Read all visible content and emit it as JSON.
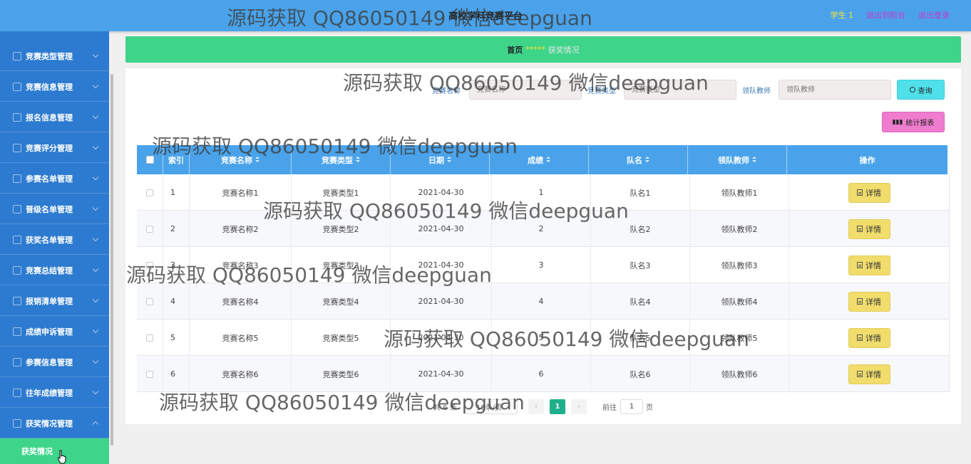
{
  "header": {
    "title": "高校学科竞赛平台",
    "user": "学生 1",
    "front_link": "退出到前台",
    "logout_link": "退出登录"
  },
  "sidebar": {
    "items": [
      {
        "label": "竞赛类型管理",
        "icon": "grid-icon"
      },
      {
        "label": "竞赛信息管理",
        "icon": "briefcase-icon"
      },
      {
        "label": "报名信息管理",
        "icon": "chat-icon"
      },
      {
        "label": "竞赛评分管理",
        "icon": "bar-chart-icon"
      },
      {
        "label": "参赛名单管理",
        "icon": "trash-icon"
      },
      {
        "label": "晋级名单管理",
        "icon": "user-icon"
      },
      {
        "label": "获奖名单管理",
        "icon": "user-icon"
      },
      {
        "label": "竞赛总结管理",
        "icon": "flag-icon"
      },
      {
        "label": "报销清单管理",
        "icon": "bulb-icon"
      },
      {
        "label": "成绩申诉管理",
        "icon": "list-icon"
      },
      {
        "label": "参赛信息管理",
        "icon": "copy-icon"
      },
      {
        "label": "往年成绩管理",
        "icon": "video-icon"
      },
      {
        "label": "获奖情况管理",
        "icon": "list-icon"
      }
    ],
    "active_sub_item": "获奖情况"
  },
  "breadcrumb": {
    "home": "首页",
    "separator": "*****",
    "current": "获奖情况"
  },
  "search": {
    "name_label": "竞赛名称",
    "name_placeholder": "竞赛名称",
    "type_label": "竞赛类型",
    "type_placeholder": "竞赛类型",
    "teacher_label": "领队教师",
    "teacher_placeholder": "领队教师",
    "query_button": "查询"
  },
  "report_button": "统计报表",
  "table": {
    "columns": [
      "索引",
      "竞赛名称",
      "竞赛类型",
      "日期",
      "成绩",
      "队名",
      "领队教师",
      "操作"
    ],
    "rows": [
      {
        "index": "1",
        "name": "竞赛名称1",
        "type": "竞赛类型1",
        "date": "2021-04-30",
        "score": "1",
        "team": "队名1",
        "teacher": "领队教师1"
      },
      {
        "index": "2",
        "name": "竞赛名称2",
        "type": "竞赛类型2",
        "date": "2021-04-30",
        "score": "2",
        "team": "队名2",
        "teacher": "领队教师2"
      },
      {
        "index": "3",
        "name": "竞赛名称3",
        "type": "竞赛类型3",
        "date": "2021-04-30",
        "score": "3",
        "team": "队名3",
        "teacher": "领队教师3"
      },
      {
        "index": "4",
        "name": "竞赛名称4",
        "type": "竞赛类型4",
        "date": "2021-04-30",
        "score": "4",
        "team": "队名4",
        "teacher": "领队教师4"
      },
      {
        "index": "5",
        "name": "竞赛名称5",
        "type": "竞赛类型5",
        "date": "2021-04-30",
        "score": "5",
        "team": "队名5",
        "teacher": "领队教师5"
      },
      {
        "index": "6",
        "name": "竞赛名称6",
        "type": "竞赛类型6",
        "date": "2021-04-30",
        "score": "6",
        "team": "队名6",
        "teacher": "领队教师6"
      }
    ],
    "detail_label": "详情"
  },
  "pagination": {
    "total": "共 6 条",
    "page_size": "10条/页",
    "current_page": "1",
    "goto_prefix": "前往",
    "goto_value": "1",
    "goto_suffix": "页"
  },
  "watermark": "源码获取 QQ86050149 微信deepguan",
  "colors": {
    "header_bg": "#4aa3ea",
    "sidebar_bg": "#2d7bd0",
    "accent_green": "#3ed48a",
    "query_button": "#4fe0ea",
    "report_button": "#ef7ccf",
    "detail_button": "#f0dd6c",
    "pager_active": "#1fb08a"
  }
}
